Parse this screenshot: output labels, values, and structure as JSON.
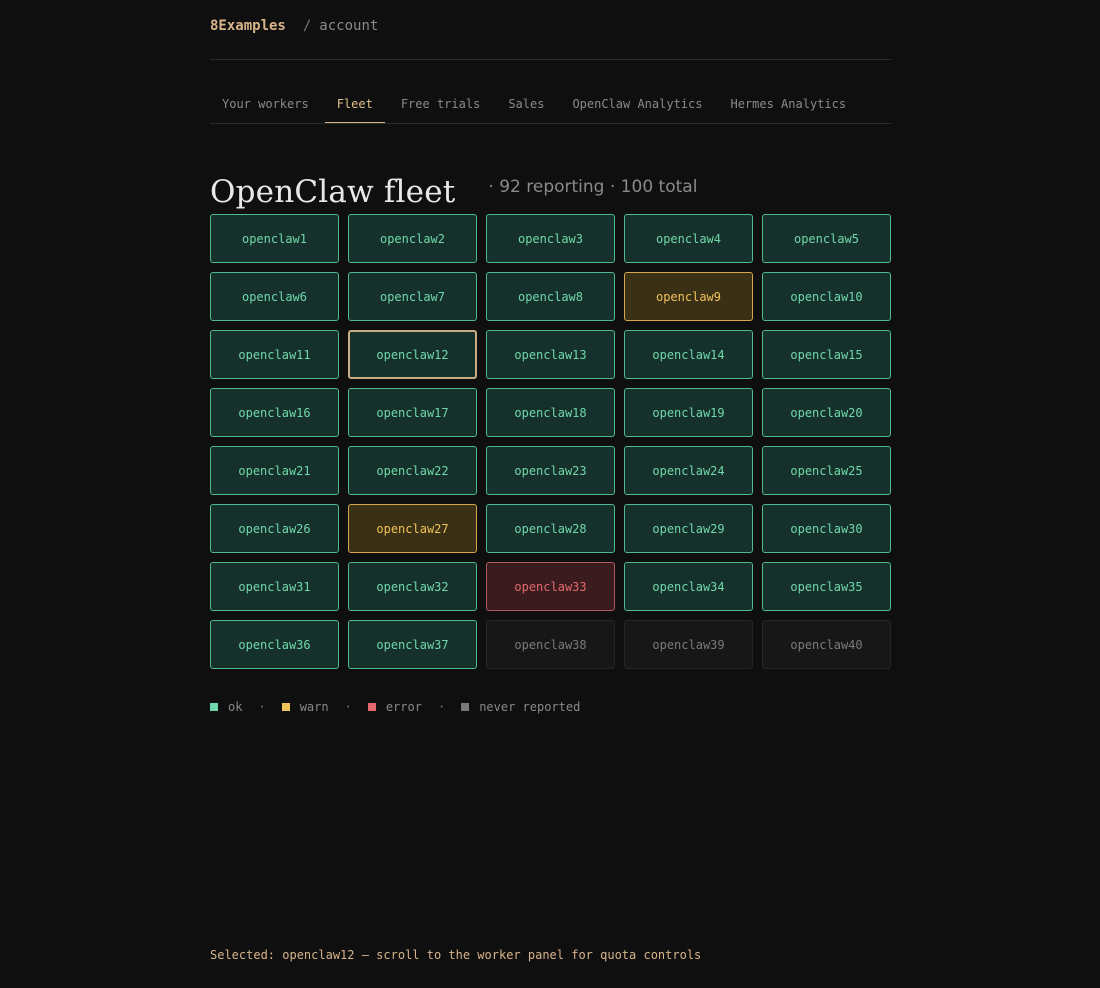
{
  "header": {
    "brand": "8Examples",
    "separator": "/",
    "crumb": "account"
  },
  "tabs": [
    {
      "label": "Your workers",
      "active": false
    },
    {
      "label": "Fleet",
      "active": true
    },
    {
      "label": "Free trials",
      "active": false
    },
    {
      "label": "Sales",
      "active": false
    },
    {
      "label": "OpenClaw Analytics",
      "active": false
    },
    {
      "label": "Hermes Analytics",
      "active": false
    }
  ],
  "main": {
    "title": "OpenClaw fleet",
    "subtitle": "· 92 reporting · 100 total"
  },
  "colors": {
    "ok": "#6fd7ab",
    "warn": "#f0c35a",
    "error": "#e3686d",
    "never": "#7a7a7a",
    "accent": "#d8b48a"
  },
  "workers": [
    {
      "name": "openclaw1",
      "status": "ok"
    },
    {
      "name": "openclaw2",
      "status": "ok"
    },
    {
      "name": "openclaw3",
      "status": "ok"
    },
    {
      "name": "openclaw4",
      "status": "ok"
    },
    {
      "name": "openclaw5",
      "status": "ok"
    },
    {
      "name": "openclaw6",
      "status": "ok"
    },
    {
      "name": "openclaw7",
      "status": "ok"
    },
    {
      "name": "openclaw8",
      "status": "ok"
    },
    {
      "name": "openclaw9",
      "status": "warn"
    },
    {
      "name": "openclaw10",
      "status": "ok"
    },
    {
      "name": "openclaw11",
      "status": "ok"
    },
    {
      "name": "openclaw12",
      "status": "ok",
      "selected": true
    },
    {
      "name": "openclaw13",
      "status": "ok"
    },
    {
      "name": "openclaw14",
      "status": "ok"
    },
    {
      "name": "openclaw15",
      "status": "ok"
    },
    {
      "name": "openclaw16",
      "status": "ok"
    },
    {
      "name": "openclaw17",
      "status": "ok"
    },
    {
      "name": "openclaw18",
      "status": "ok"
    },
    {
      "name": "openclaw19",
      "status": "ok"
    },
    {
      "name": "openclaw20",
      "status": "ok"
    },
    {
      "name": "openclaw21",
      "status": "ok"
    },
    {
      "name": "openclaw22",
      "status": "ok"
    },
    {
      "name": "openclaw23",
      "status": "ok"
    },
    {
      "name": "openclaw24",
      "status": "ok"
    },
    {
      "name": "openclaw25",
      "status": "ok"
    },
    {
      "name": "openclaw26",
      "status": "ok"
    },
    {
      "name": "openclaw27",
      "status": "warn"
    },
    {
      "name": "openclaw28",
      "status": "ok"
    },
    {
      "name": "openclaw29",
      "status": "ok"
    },
    {
      "name": "openclaw30",
      "status": "ok"
    },
    {
      "name": "openclaw31",
      "status": "ok"
    },
    {
      "name": "openclaw32",
      "status": "ok"
    },
    {
      "name": "openclaw33",
      "status": "error"
    },
    {
      "name": "openclaw34",
      "status": "ok"
    },
    {
      "name": "openclaw35",
      "status": "ok"
    },
    {
      "name": "openclaw36",
      "status": "ok"
    },
    {
      "name": "openclaw37",
      "status": "ok"
    },
    {
      "name": "openclaw38",
      "status": "never"
    },
    {
      "name": "openclaw39",
      "status": "never"
    },
    {
      "name": "openclaw40",
      "status": "never"
    }
  ],
  "legend": {
    "separator": "·",
    "items": [
      {
        "label": "ok",
        "status": "ok"
      },
      {
        "label": "warn",
        "status": "warn"
      },
      {
        "label": "error",
        "status": "error"
      },
      {
        "label": "never reported",
        "status": "never"
      }
    ]
  },
  "footer": {
    "selected_text": "Selected: openclaw12 — scroll to the worker panel for quota controls"
  }
}
